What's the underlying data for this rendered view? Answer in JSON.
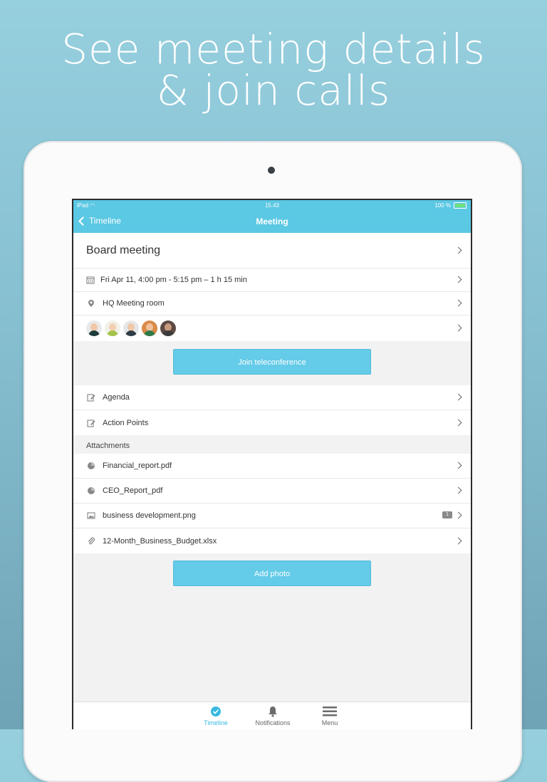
{
  "promo": {
    "line1": "See meeting details",
    "line2": "& join calls"
  },
  "status_bar": {
    "device": "iPad",
    "time": "15.43",
    "battery": "100 %"
  },
  "nav": {
    "back_label": "Timeline",
    "title": "Meeting"
  },
  "meeting": {
    "title": "Board meeting",
    "datetime": "Fri Apr 11, 4:00 pm - 5:15 pm – 1 h 15 min",
    "location": "HQ Meeting room",
    "participant_count": 5
  },
  "buttons": {
    "join": "Join teleconference",
    "add_photo": "Add photo"
  },
  "notes": [
    {
      "label": "Agenda",
      "icon": "edit-icon"
    },
    {
      "label": "Action Points",
      "icon": "edit-icon"
    }
  ],
  "attachments_header": "Attachments",
  "attachments": [
    {
      "name": "Financial_report.pdf",
      "icon": "pie-chart-icon"
    },
    {
      "name": "CEO_Report_pdf",
      "icon": "pie-chart-icon"
    },
    {
      "name": "business development.png",
      "icon": "image-icon",
      "comments": "1"
    },
    {
      "name": "12-Month_Business_Budget.xlsx",
      "icon": "paperclip-icon"
    }
  ],
  "tabs": [
    {
      "label": "Timeline",
      "icon": "timeline-check-icon",
      "active": true
    },
    {
      "label": "Notifications",
      "icon": "bell-icon",
      "active": false
    },
    {
      "label": "Menu",
      "icon": "hamburger-icon",
      "active": false
    }
  ],
  "colors": {
    "accent": "#5bc8e4",
    "button": "#64cbe8",
    "tab_active": "#39b9e0"
  }
}
